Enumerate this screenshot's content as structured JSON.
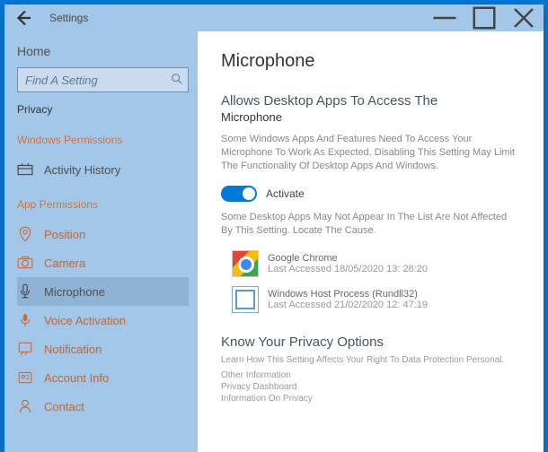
{
  "titlebar": {
    "title": "Settings"
  },
  "sidebar": {
    "home": "Home",
    "search_placeholder": "Find A Setting",
    "crumb": "Privacy",
    "section1": "Windows Permissions",
    "section2": "App Permissions",
    "items1": [
      {
        "label": "Activity History"
      }
    ],
    "items2": [
      {
        "label": "Position"
      },
      {
        "label": "Camera"
      },
      {
        "label": "Microphone"
      },
      {
        "label": "Voice Activation"
      },
      {
        "label": "Notification"
      },
      {
        "label": "Account Info"
      },
      {
        "label": "Contact"
      }
    ]
  },
  "content": {
    "title": "Microphone",
    "sub1a": "Allows Desktop Apps To Access The",
    "sub1b": "Microphone",
    "desc1": "Some Windows Apps And Features Need To Access Your Microphone To Work As Expected. Disabling This Setting May Limit The Functionality Of Desktop Apps And Windows.",
    "toggle_label": "Activate",
    "desc2": "Some Desktop Apps May Not Appear In The List Are Not Affected By This Setting. Locate The Cause.",
    "apps": [
      {
        "name": "Google Chrome",
        "time": "Last Accessed 18/05/2020 13: 28:20"
      },
      {
        "name": "Windows Host Process (Rundll32)",
        "time": "Last Accessed 21/02/2020 12: 47:19"
      }
    ],
    "footer_head": "Know Your Privacy Options",
    "footer_desc": "Learn How This Setting Affects Your Right To Data Protection Personal.",
    "footer_links": [
      "Other Information",
      "Privacy Dashboard",
      "Information On Privacy"
    ]
  }
}
